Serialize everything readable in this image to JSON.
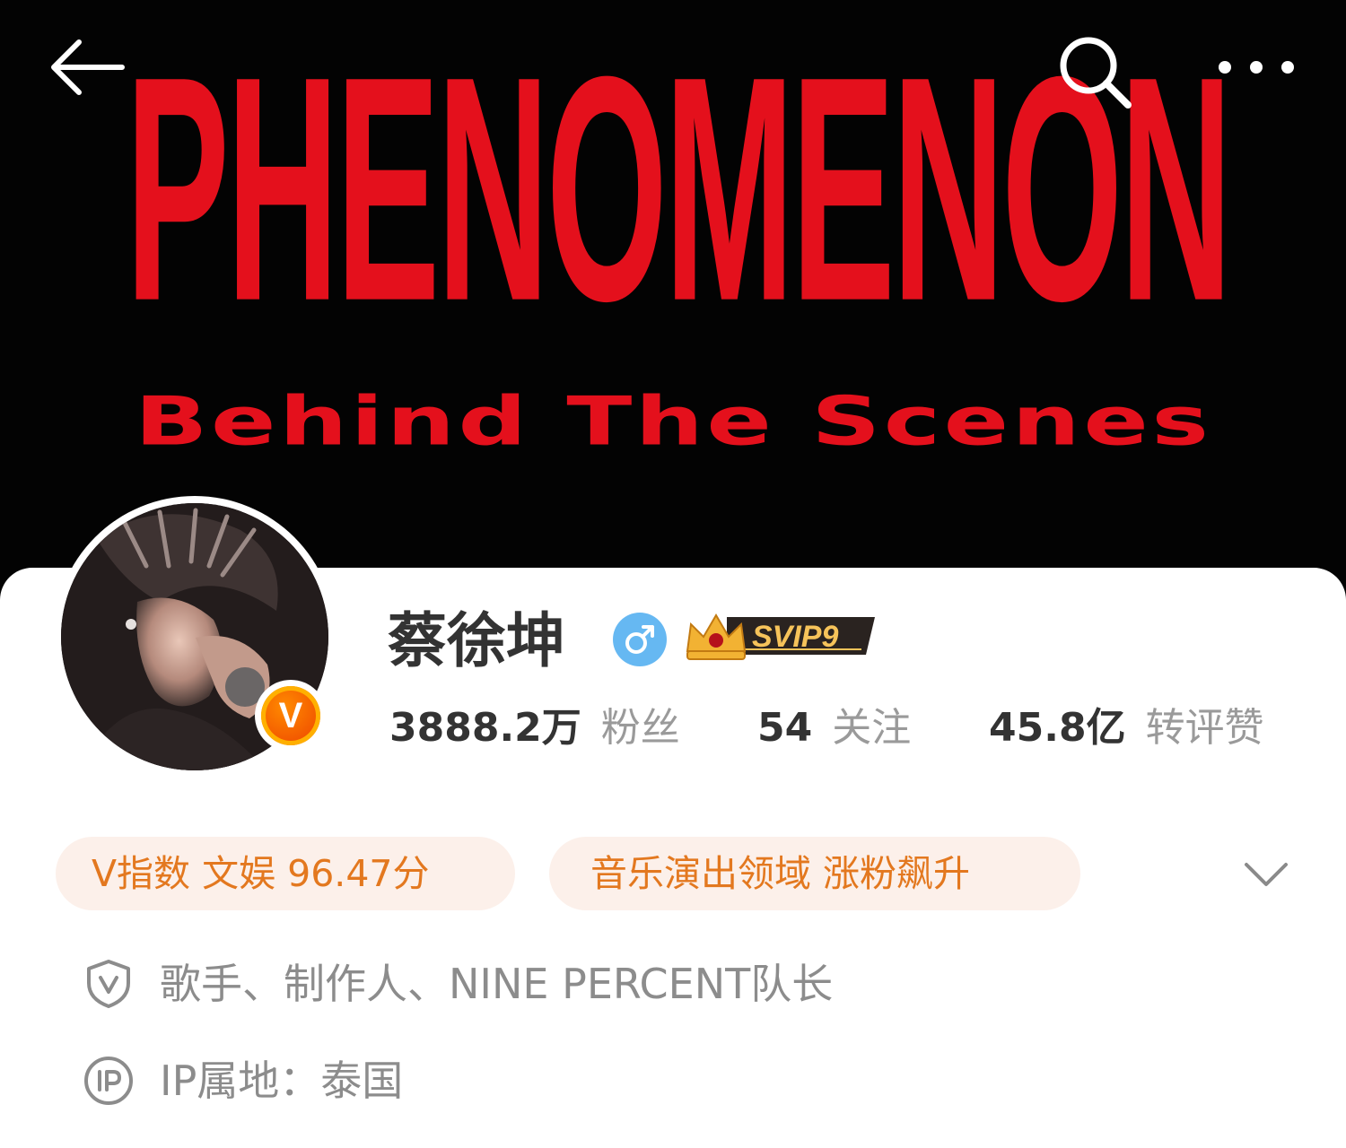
{
  "banner": {
    "title": "PHENOMENON",
    "subtitle": "Behind The Scenes",
    "title_color": "#e4101c",
    "background": "#030303"
  },
  "topbar": {
    "back_icon": "arrow-left-icon",
    "search_icon": "search-icon",
    "more_icon": "more-dots-icon"
  },
  "profile": {
    "name": "蔡徐坤",
    "gender_icon": "male-icon",
    "gender_color": "#66b8f2",
    "vip_badge": "SVIP9",
    "verified_icon": "verified-v-icon",
    "verified_mark": "V"
  },
  "stats": {
    "followers_value": "3888.2万",
    "followers_label": "粉丝",
    "following_value": "54",
    "following_label": "关注",
    "likes_value": "45.8亿",
    "likes_label": "转评赞"
  },
  "tags": {
    "vindex": "V指数 文娱 96.47分",
    "trend": "音乐演出领域 涨粉飙升",
    "tag_text_color": "#e3781f",
    "tag_bg_color": "#fcf0ea"
  },
  "info": {
    "certification": "歌手、制作人、NINE PERCENT队长",
    "cert_icon": "shield-v-icon",
    "ip_location": "IP属地：泰国",
    "ip_icon": "ip-icon"
  }
}
